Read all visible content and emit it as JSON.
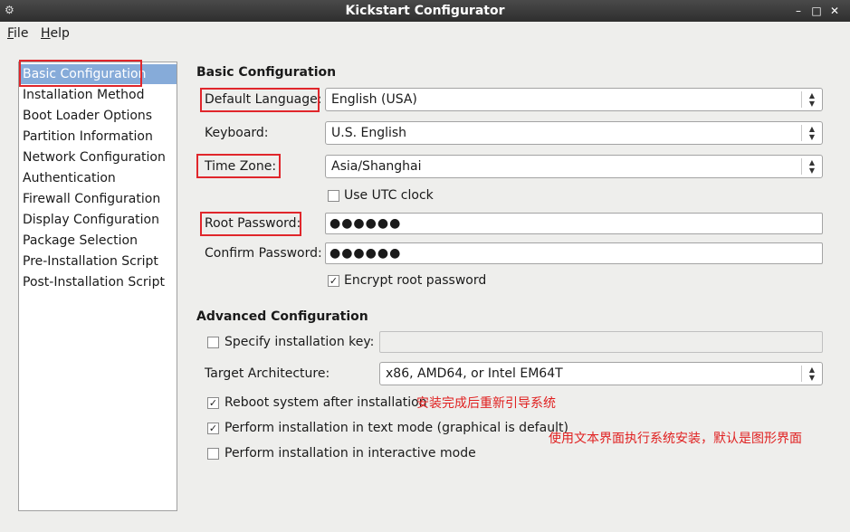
{
  "window": {
    "title": "Kickstart Configurator"
  },
  "menu": {
    "file": "File",
    "file_mnemonic": "F",
    "file_rest": "ile",
    "help": "Help",
    "help_mnemonic": "H",
    "help_rest": "elp"
  },
  "sidebar": {
    "items": [
      {
        "label": "Basic Configuration",
        "selected": true
      },
      {
        "label": "Installation Method"
      },
      {
        "label": "Boot Loader Options"
      },
      {
        "label": "Partition Information"
      },
      {
        "label": "Network Configuration"
      },
      {
        "label": "Authentication"
      },
      {
        "label": "Firewall Configuration"
      },
      {
        "label": "Display Configuration"
      },
      {
        "label": "Package Selection"
      },
      {
        "label": "Pre-Installation Script"
      },
      {
        "label": "Post-Installation Script"
      }
    ]
  },
  "basic": {
    "title": "Basic Configuration",
    "language_label": "Default Language:",
    "language_value": "English (USA)",
    "keyboard_label": "Keyboard:",
    "keyboard_value": "U.S. English",
    "timezone_label": "Time Zone:",
    "timezone_value": "Asia/Shanghai",
    "utc_label": "Use UTC clock",
    "utc_checked": false,
    "root_pw_label": "Root Password:",
    "root_pw_value": "●●●●●●",
    "confirm_pw_label": "Confirm Password:",
    "confirm_pw_value": "●●●●●●",
    "encrypt_label": "Encrypt root password",
    "encrypt_checked": true
  },
  "advanced": {
    "title": "Advanced Configuration",
    "install_key_label": "Specify installation key:",
    "install_key_checked": false,
    "install_key_value": "",
    "arch_label": "Target Architecture:",
    "arch_value": "x86, AMD64, or Intel EM64T",
    "reboot_label": "Reboot system after installation",
    "reboot_checked": true,
    "textmode_label": "Perform installation in text mode (graphical is default)",
    "textmode_checked": true,
    "interactive_label": "Perform installation in interactive mode",
    "interactive_checked": false
  },
  "annotations": {
    "reboot_note": "安装完成后重新引导系统",
    "textmode_note": "使用文本界面执行系统安装，默认是图形界面"
  },
  "colors": {
    "highlight": "#e0262b",
    "selection": "#86abd9",
    "annotation_text": "#e02020"
  }
}
